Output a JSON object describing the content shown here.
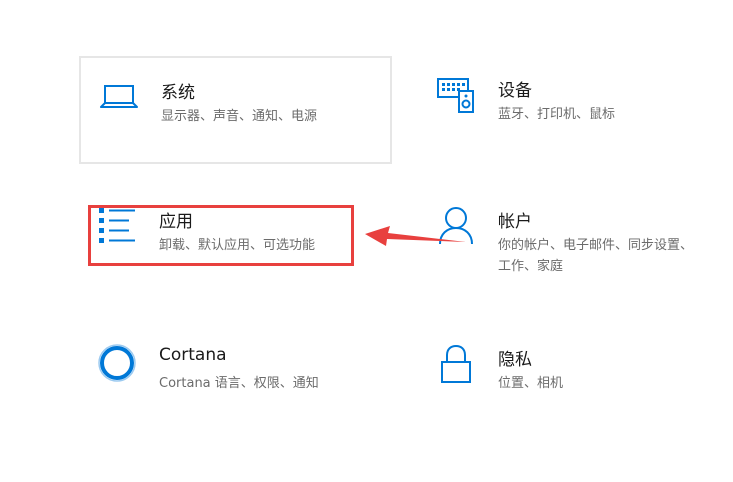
{
  "colors": {
    "accent": "#0078d7",
    "highlight": "#e8403e",
    "title": "#1a1a1a",
    "description": "#6b6b6b"
  },
  "tiles": [
    {
      "key": "system",
      "icon": "laptop-icon",
      "title": "系统",
      "description": "显示器、声音、通知、电源"
    },
    {
      "key": "devices",
      "icon": "keyboard-speaker-icon",
      "title": "设备",
      "description": "蓝牙、打印机、鼠标"
    },
    {
      "key": "apps",
      "icon": "apps-list-icon",
      "title": "应用",
      "description": "卸载、默认应用、可选功能"
    },
    {
      "key": "accounts",
      "icon": "person-icon",
      "title": "帐户",
      "description": "你的帐户、电子邮件、同步设置、工作、家庭"
    },
    {
      "key": "cortana",
      "icon": "cortana-ring-icon",
      "title": "Cortana",
      "description": "Cortana 语言、权限、通知"
    },
    {
      "key": "privacy",
      "icon": "lock-icon",
      "title": "隐私",
      "description": "位置、相机"
    }
  ]
}
